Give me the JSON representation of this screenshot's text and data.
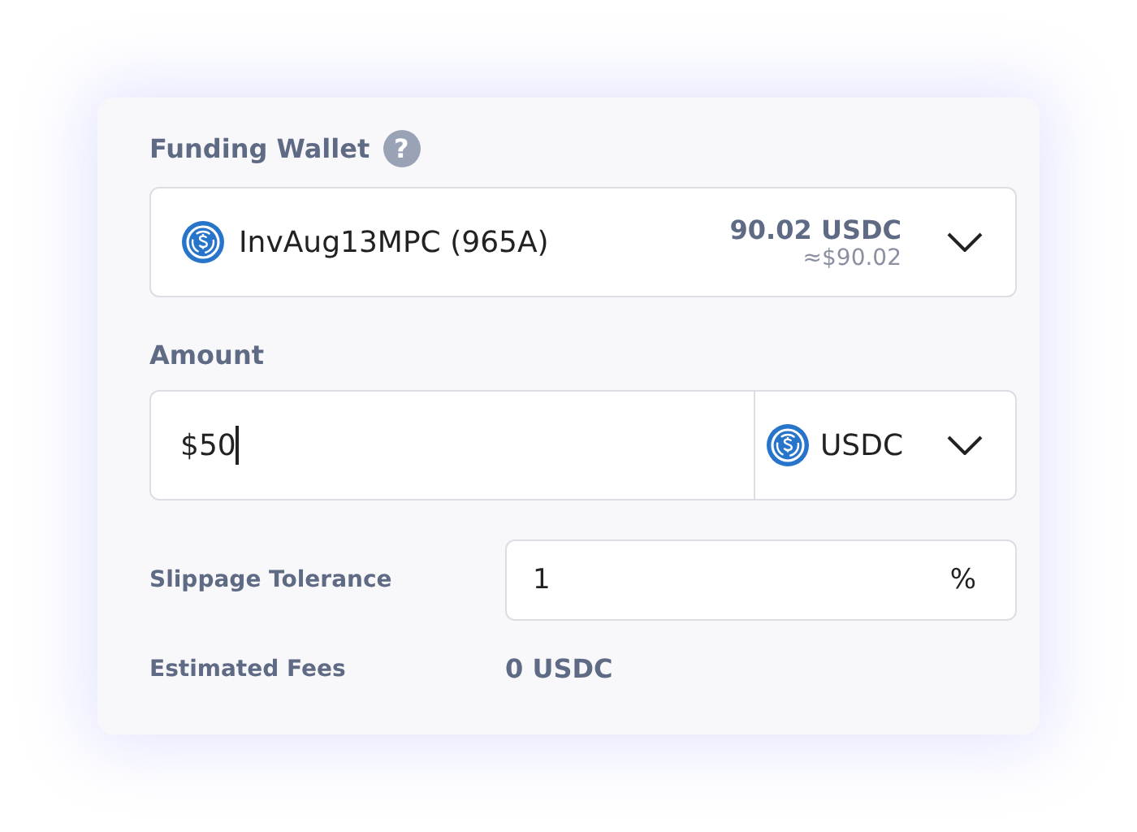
{
  "funding_wallet": {
    "label": "Funding Wallet",
    "help_icon": "?",
    "wallet_name": "InvAug13MPC (965A)",
    "balance": "90.02 USDC",
    "balance_usd": "≈$90.02"
  },
  "amount": {
    "label": "Amount",
    "value": "$50",
    "currency": "USDC",
    "focused": true
  },
  "slippage": {
    "label": "Slippage Tolerance",
    "value": "1",
    "unit": "%"
  },
  "fees": {
    "label": "Estimated Fees",
    "value": "0 USDC"
  }
}
